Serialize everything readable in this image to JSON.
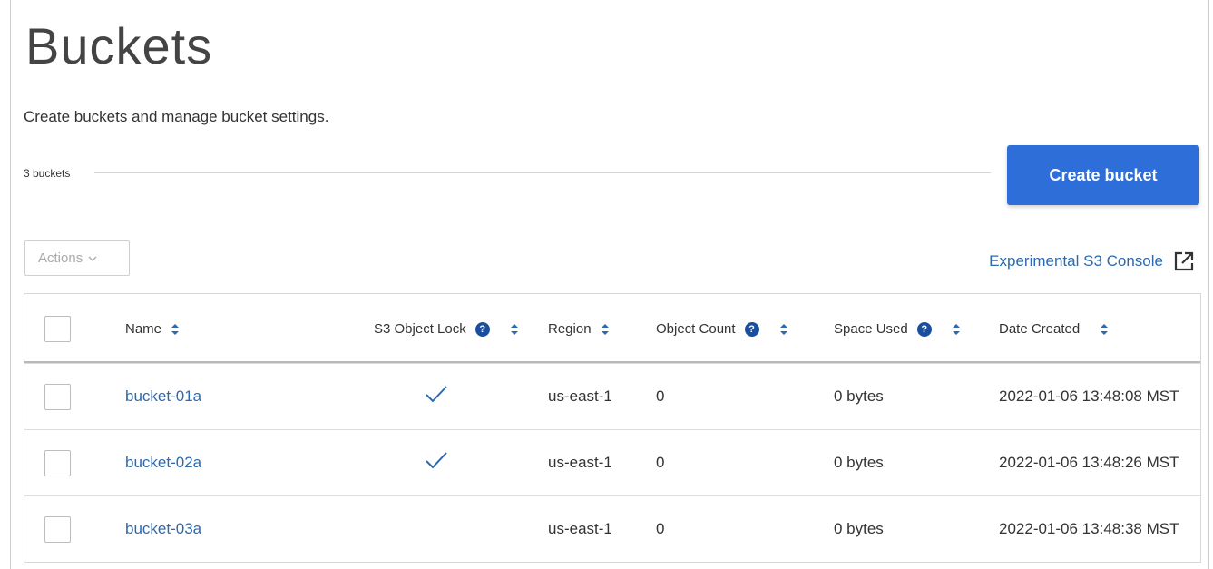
{
  "page": {
    "title": "Buckets",
    "subtitle": "Create buckets and manage bucket settings.",
    "bucket_count": "3 buckets"
  },
  "toolbar": {
    "create_label": "Create bucket",
    "actions_label": "Actions",
    "console_link": "Experimental S3 Console"
  },
  "colors": {
    "primary": "#2e6ed8",
    "link": "#2b6ab0",
    "help_icon": "#1a4fa0"
  },
  "table": {
    "headers": {
      "name": "Name",
      "object_lock": "S3 Object Lock",
      "region": "Region",
      "object_count": "Object Count",
      "space_used": "Space Used",
      "date_created": "Date Created"
    },
    "rows": [
      {
        "name": "bucket-01a",
        "object_lock": true,
        "region": "us-east-1",
        "object_count": "0",
        "space_used": "0 bytes",
        "date_created": "2022-01-06 13:48:08 MST"
      },
      {
        "name": "bucket-02a",
        "object_lock": true,
        "region": "us-east-1",
        "object_count": "0",
        "space_used": "0 bytes",
        "date_created": "2022-01-06 13:48:26 MST"
      },
      {
        "name": "bucket-03a",
        "object_lock": false,
        "region": "us-east-1",
        "object_count": "0",
        "space_used": "0 bytes",
        "date_created": "2022-01-06 13:48:38 MST"
      }
    ]
  }
}
